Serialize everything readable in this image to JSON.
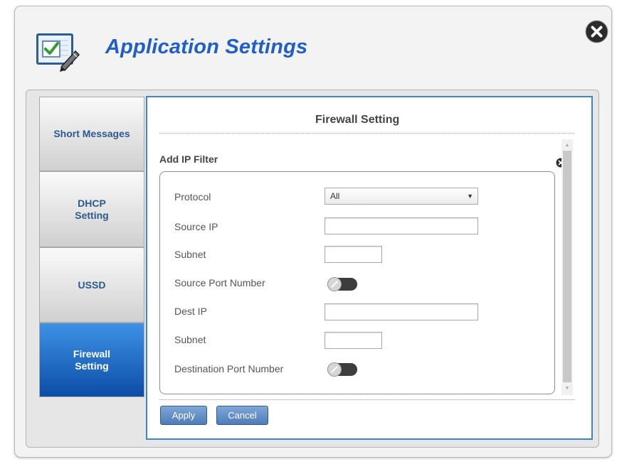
{
  "dialog": {
    "title": "Application Settings"
  },
  "colors": {
    "title": "#1f5fc7",
    "active_tab": "#0c4da6",
    "panel_border": "#3a87cc",
    "button": "#5a87c0"
  },
  "icons": {
    "app": "settings-checklist-icon",
    "close": "close-icon"
  },
  "tabs": [
    {
      "lines": [
        "Short Messages"
      ],
      "active": false
    },
    {
      "lines": [
        "DHCP",
        "Setting"
      ],
      "active": false
    },
    {
      "lines": [
        "USSD"
      ],
      "active": false
    },
    {
      "lines": [
        "Firewall",
        "Setting"
      ],
      "active": true
    }
  ],
  "panel": {
    "title": "Firewall Setting",
    "subtitle": "Add IP Filter"
  },
  "form": {
    "protocol": {
      "label": "Protocol",
      "value": "All"
    },
    "source_ip": {
      "label": "Source IP",
      "value": ""
    },
    "source_subnet": {
      "label": "Subnet",
      "value": ""
    },
    "source_port": {
      "label": "Source Port Number",
      "enabled": false
    },
    "dest_ip": {
      "label": "Dest IP",
      "value": ""
    },
    "dest_subnet": {
      "label": "Subnet",
      "value": ""
    },
    "dest_port": {
      "label": "Destination Port Number",
      "enabled": false
    }
  },
  "buttons": {
    "apply": "Apply",
    "cancel": "Cancel"
  }
}
